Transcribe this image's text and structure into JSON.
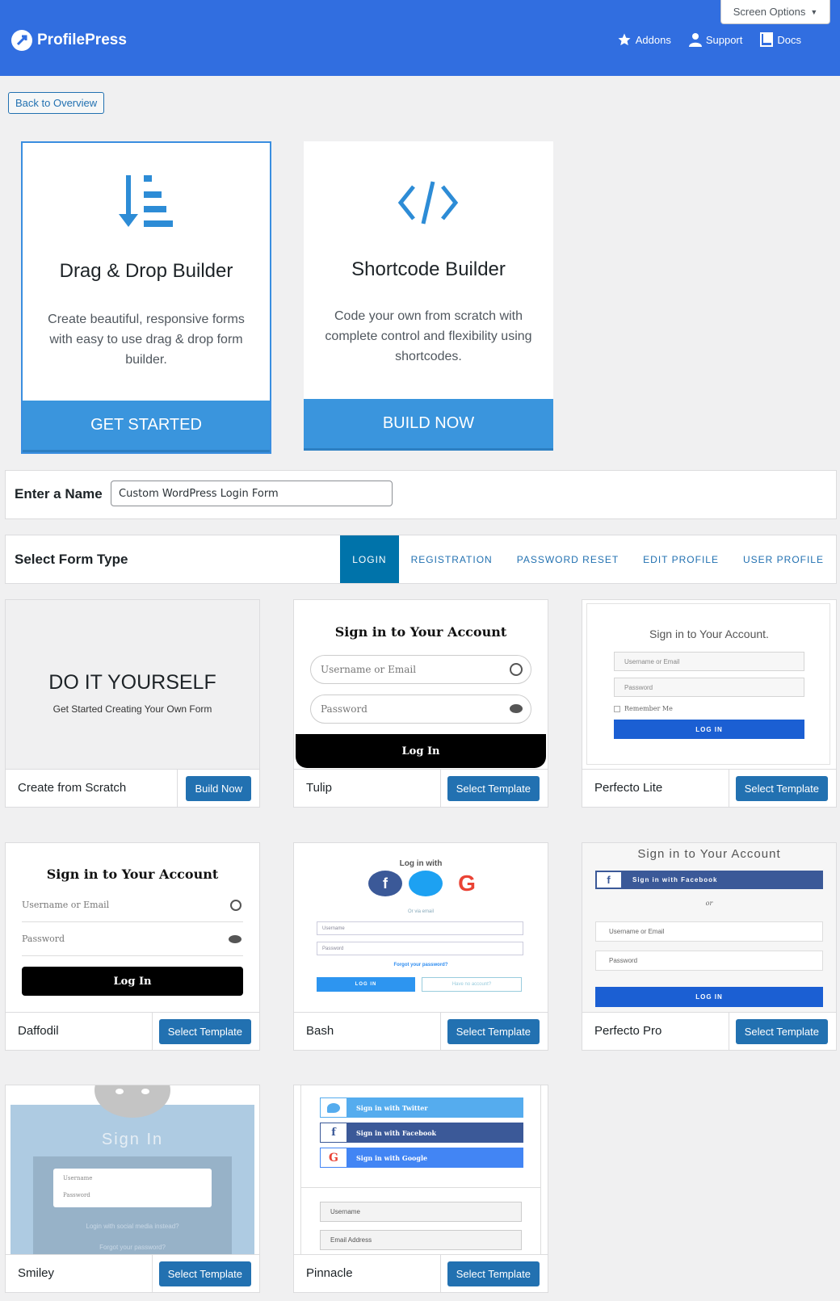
{
  "header": {
    "logo_text": "ProfilePress",
    "screen_options": "Screen Options",
    "nav": [
      {
        "label": "Addons",
        "icon": "star-icon"
      },
      {
        "label": "Support",
        "icon": "user-icon"
      },
      {
        "label": "Docs",
        "icon": "book-icon"
      }
    ]
  },
  "back_button": "Back to Overview",
  "builders": [
    {
      "title": "Drag & Drop Builder",
      "description": "Create beautiful, responsive forms with easy to use drag & drop form builder.",
      "cta": "GET STARTED",
      "icon": "drag-drop-icon",
      "selected": true
    },
    {
      "title": "Shortcode Builder",
      "description": "Code your own from scratch with complete control and flexibility using shortcodes.",
      "cta": "BUILD NOW",
      "icon": "code-icon",
      "selected": false
    }
  ],
  "name_row": {
    "label": "Enter a Name",
    "value": "Custom WordPress Login Form"
  },
  "form_type": {
    "label": "Select Form Type",
    "tabs": [
      "LOGIN",
      "REGISTRATION",
      "PASSWORD RESET",
      "EDIT PROFILE",
      "USER PROFILE"
    ],
    "active": "LOGIN"
  },
  "templates": [
    {
      "name": "Create from Scratch",
      "button": "Build Now",
      "preview": {
        "title": "DO IT YOURSELF",
        "subtitle": "Get Started Creating Your Own Form"
      }
    },
    {
      "name": "Tulip",
      "button": "Select Template",
      "preview": {
        "title": "Sign in to Your Account",
        "username": "Username or Email",
        "password": "Password",
        "submit": "Log In"
      }
    },
    {
      "name": "Perfecto Lite",
      "button": "Select Template",
      "preview": {
        "title": "Sign in to Your Account.",
        "username": "Username or Email",
        "password": "Password",
        "remember": "Remember Me",
        "submit": "LOG IN"
      }
    },
    {
      "name": "Daffodil",
      "button": "Select Template",
      "preview": {
        "title": "Sign in to Your Account",
        "username": "Username or Email",
        "password": "Password",
        "submit": "Log In"
      }
    },
    {
      "name": "Bash",
      "button": "Select Template",
      "preview": {
        "title": "Log in with",
        "via": "Or via email",
        "username": "Username",
        "password": "Password",
        "forgot": "Forgot your password?",
        "submit": "LOG IN",
        "secondary": "Have no account?"
      }
    },
    {
      "name": "Perfecto Pro",
      "button": "Select Template",
      "preview": {
        "title": "Sign in to Your Account",
        "facebook": "Sign in with Facebook",
        "or": "or",
        "username": "Username or Email",
        "password": "Password",
        "submit": "LOG IN"
      }
    },
    {
      "name": "Smiley",
      "button": "Select Template",
      "preview": {
        "title": "Sign In",
        "username": "Username",
        "password": "Password",
        "social": "Login with social media instead?",
        "forgot": "Forgot your password?"
      }
    },
    {
      "name": "Pinnacle",
      "button": "Select Template",
      "preview": {
        "twitter": "Sign in with Twitter",
        "facebook": "Sign in with Facebook",
        "google": "Sign in with Google",
        "username": "Username",
        "email": "Email Address"
      }
    }
  ],
  "colors": {
    "header": "#316ee0",
    "primary": "#2271b1",
    "cta": "#3a95dd",
    "active_tab": "#0073aa"
  }
}
